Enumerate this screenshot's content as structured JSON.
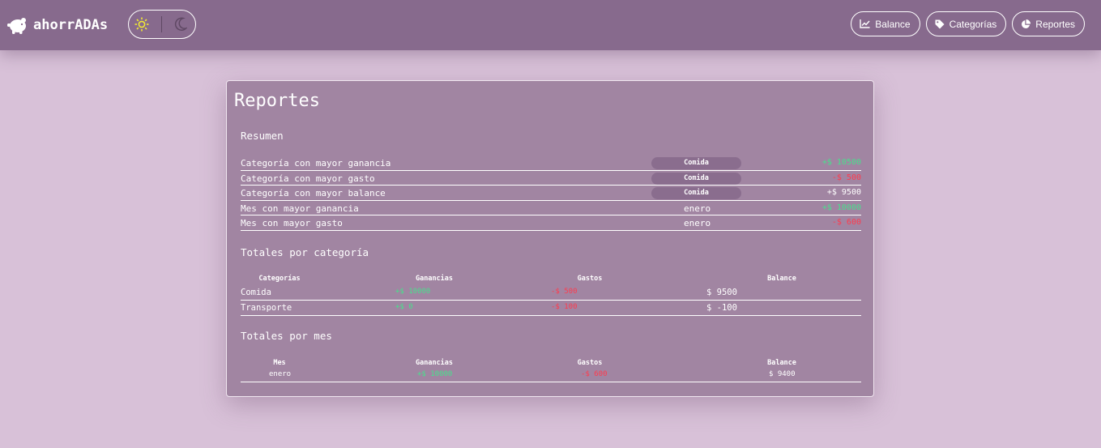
{
  "header": {
    "brand": "ahorrADAs",
    "nav": [
      {
        "label": "Balance",
        "icon": "chart-line-icon"
      },
      {
        "label": "Categorías",
        "icon": "tag-icon"
      },
      {
        "label": "Reportes",
        "icon": "pie-chart-icon"
      }
    ],
    "theme_icons": [
      "sun-icon",
      "moon-icon"
    ]
  },
  "report": {
    "title": "Reportes",
    "summary": {
      "title": "Resumen",
      "rows": [
        {
          "label": "Categoría con mayor ganancia",
          "value": "Comida",
          "amount": "+$ 10500",
          "tone": "green",
          "pill": true
        },
        {
          "label": "Categoría con mayor gasto",
          "value": "Comida",
          "amount": "-$ 500",
          "tone": "red",
          "pill": true
        },
        {
          "label": "Categoría con mayor balance",
          "value": "Comida",
          "amount": "+$ 9500",
          "tone": "white",
          "pill": true
        },
        {
          "label": "Mes con mayor ganancia",
          "value": "enero",
          "amount": "+$ 10000",
          "tone": "green",
          "pill": false
        },
        {
          "label": "Mes con mayor gasto",
          "value": "enero",
          "amount": "-$ 600",
          "tone": "red",
          "pill": false
        }
      ]
    },
    "by_category": {
      "title": "Totales por categoría",
      "headers": [
        "Categorías",
        "Ganancias",
        "Gastos",
        "Balance"
      ],
      "rows": [
        {
          "name": "Comida",
          "income": "+$ 10000",
          "expense": "-$ 500",
          "balance": "$ 9500"
        },
        {
          "name": "Transporte",
          "income": "+$ 0",
          "expense": "-$ 100",
          "balance": "$ -100"
        }
      ]
    },
    "by_month": {
      "title": "Totales por mes",
      "headers": [
        "Mes",
        "Ganancias",
        "Gastos",
        "Balance"
      ],
      "rows": [
        {
          "name": "enero",
          "income": "+$ 10000",
          "expense": "-$ 600",
          "balance": "$ 9400"
        }
      ]
    }
  },
  "colors": {
    "navbar": "#876a8d",
    "page_background": "#d8c1d8",
    "card": "#a185a2",
    "positive": "#48e08c",
    "negative": "#ff3b4e",
    "sun": "#f2e933"
  }
}
